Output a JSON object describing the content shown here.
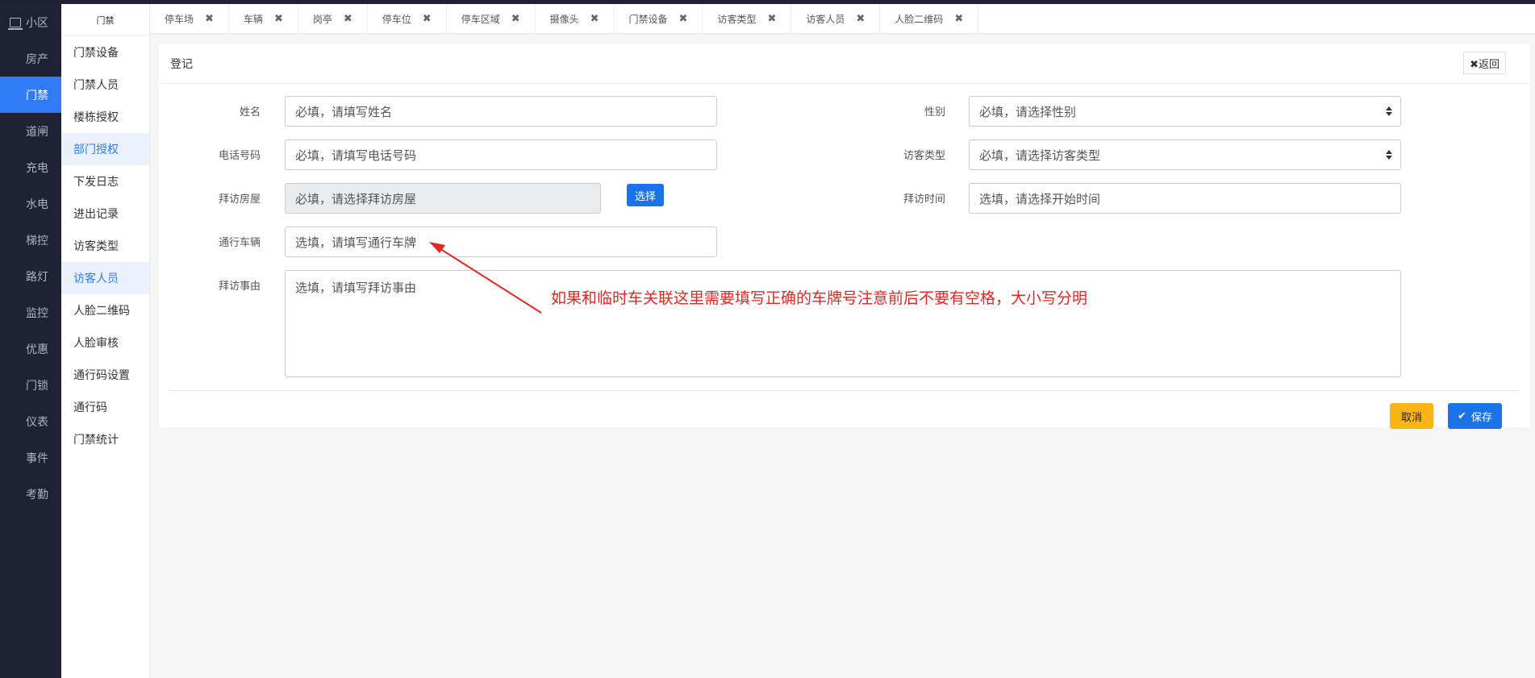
{
  "rail": {
    "items": [
      {
        "label": "小区",
        "icon": "monitor-icon"
      },
      {
        "label": "房产",
        "icon": "grid-icon"
      },
      {
        "label": "门禁",
        "icon": "grid-icon",
        "active": true
      },
      {
        "label": "道闸",
        "icon": "grid-icon"
      },
      {
        "label": "充电",
        "icon": "grid-icon"
      },
      {
        "label": "水电",
        "icon": "grid-icon"
      },
      {
        "label": "梯控",
        "icon": "grid-icon"
      },
      {
        "label": "路灯",
        "icon": "grid-icon"
      },
      {
        "label": "监控",
        "icon": "grid-icon"
      },
      {
        "label": "优惠",
        "icon": "grid-icon"
      },
      {
        "label": "门锁",
        "icon": "grid-icon"
      },
      {
        "label": "仪表",
        "icon": "grid-icon"
      },
      {
        "label": "事件",
        "icon": "grid-icon"
      },
      {
        "label": "考勤",
        "icon": "grid-icon"
      }
    ]
  },
  "submenu": {
    "title": "门禁",
    "items": [
      "门禁设备",
      "门禁人员",
      "楼栋授权",
      "部门授权",
      "下发日志",
      "进出记录",
      "访客类型",
      "访客人员",
      "人脸二维码",
      "人脸审核",
      "通行码设置",
      "通行码",
      "门禁统计"
    ]
  },
  "tabs": [
    "停车场",
    "车辆",
    "岗亭",
    "停车位",
    "停车区域",
    "摄像头",
    "门禁设备",
    "访客类型",
    "访客人员",
    "人脸二维码"
  ],
  "panel": {
    "title": "登记",
    "back_label": "✖返回"
  },
  "form": {
    "name_label": "姓名",
    "name_placeholder": "必填，请填写姓名",
    "gender_label": "性别",
    "gender_value": "必填，请选择性别",
    "phone_label": "电话号码",
    "phone_placeholder": "必填，请填写电话号码",
    "visitor_type_label": "访客类型",
    "visitor_type_value": "必填，请选择访客类型",
    "house_label": "拜访房屋",
    "house_placeholder": "必填，请选择拜访房屋",
    "choose_label": "选择",
    "time_label": "拜访时间",
    "time_placeholder": "选填，请选择开始时间",
    "vehicle_label": "通行车辆",
    "vehicle_placeholder": "选填，请填写通行车牌",
    "reason_label": "拜访事由",
    "reason_placeholder": "选填，请填写拜访事由"
  },
  "actions": {
    "cancel_label": "取消",
    "save_label": "保存"
  },
  "annotation": {
    "text": "如果和临时车关联这里需要填写正确的车牌号注意前后不要有空格，大小写分明",
    "color": "#e52622"
  },
  "colors": {
    "accent": "#2f7cf6",
    "rail_bg": "#1f2235",
    "cancel": "#fbb417"
  }
}
